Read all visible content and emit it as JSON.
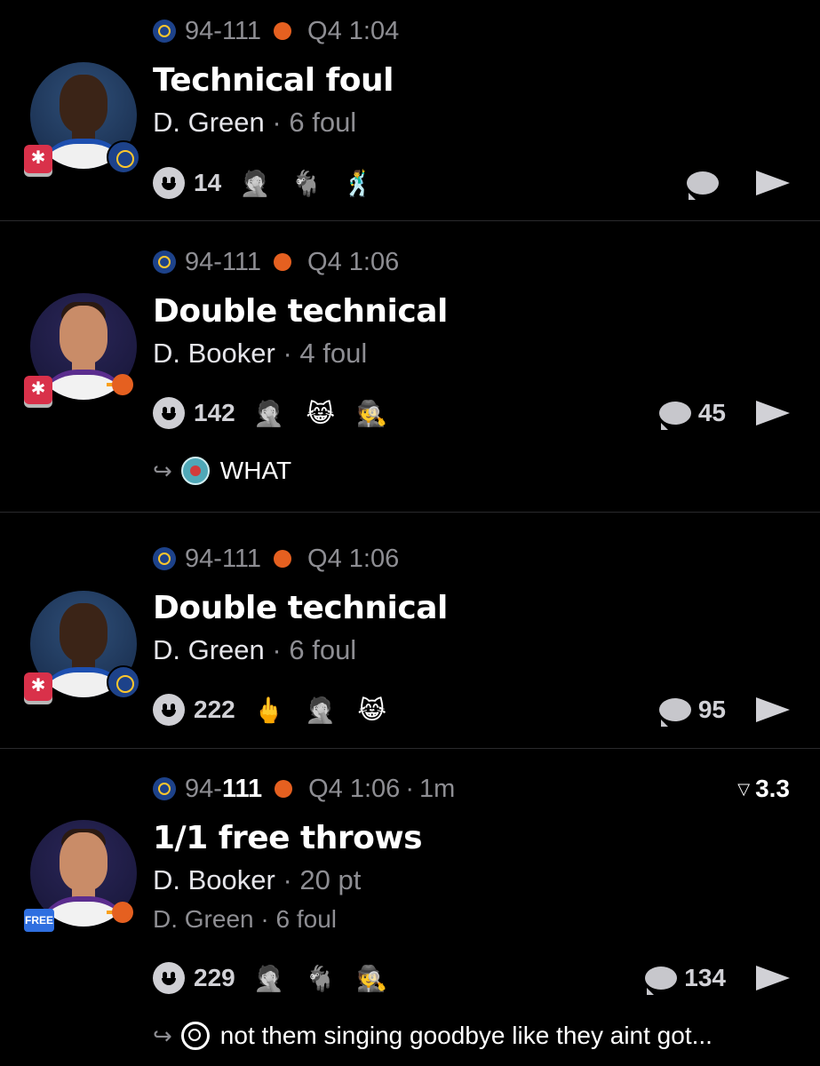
{
  "feed": {
    "items": [
      {
        "score_left": "94",
        "score_right": "111",
        "period": "Q4 1:04",
        "title": "Technical foul",
        "player": "D. Green",
        "stat": "6 foul",
        "reaction_count": "14",
        "comment_count": "",
        "team": "GSW"
      },
      {
        "score_left": "94",
        "score_right": "111",
        "period": "Q4 1:06",
        "title": "Double technical",
        "player": "D. Booker",
        "stat": "4 foul",
        "reaction_count": "142",
        "comment_count": "45",
        "reply_text": "WHAT",
        "team": "PHX"
      },
      {
        "score_left": "94",
        "score_right": "111",
        "period": "Q4 1:06",
        "title": "Double technical",
        "player": "D. Green",
        "stat": "6 foul",
        "reaction_count": "222",
        "comment_count": "95",
        "team": "GSW"
      },
      {
        "score_left": "94",
        "score_right": "111",
        "period": "Q4 1:06",
        "age": "1m",
        "odds": "3.3",
        "title": "1/1 free throws",
        "player": "D. Booker",
        "stat": "20 pt",
        "secondary_player": "D. Green",
        "secondary_stat": "6 foul",
        "reaction_count": "229",
        "comment_count": "134",
        "reply_text": "not them singing goodbye like they aint got...",
        "badge": "FREE",
        "team": "PHX"
      }
    ]
  },
  "common": {
    "dash": "-",
    "dot": "·"
  },
  "icons": {
    "reaction": "smiley-icon",
    "comment": "comment-bubble-icon",
    "share": "send-icon",
    "reply": "reply-arrow-icon",
    "alert": "siren-icon",
    "emoji_1": "🤦",
    "emoji_2": "🐐",
    "emoji_3": "🕺",
    "emoji_4": "😹",
    "emoji_5": "🕵",
    "emoji_6": "🖕"
  },
  "colors": {
    "background": "#000000",
    "muted": "#8e8e93",
    "gsw": "#1d428a",
    "phx": "#e56020",
    "alert": "#d9314a"
  }
}
